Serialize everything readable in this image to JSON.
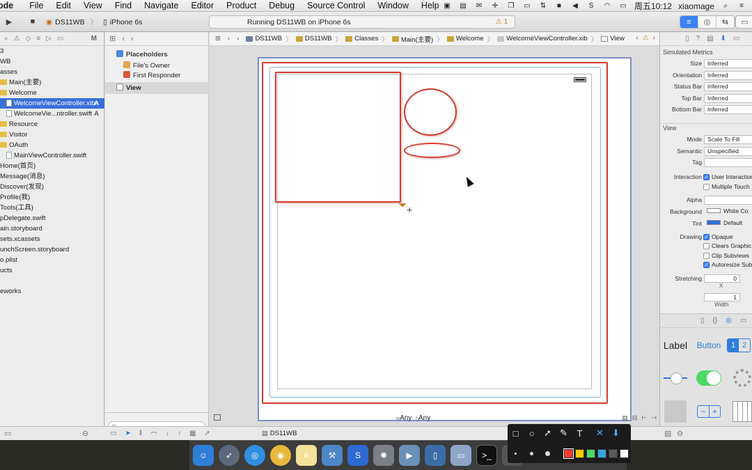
{
  "menubar": {
    "app_name": "ode",
    "items": [
      "File",
      "Edit",
      "View",
      "Find",
      "Navigate",
      "Editor",
      "Product",
      "Debug",
      "Source Control",
      "Window",
      "Help"
    ],
    "clock": "周五10:12",
    "user": "xiaomage"
  },
  "toolbar": {
    "scheme": "DS11WB",
    "device": "iPhone 6s",
    "activity_text": "Running DS11WB on iPhone 6s",
    "warning_count": "1"
  },
  "navigator": {
    "modified_header": "M",
    "items": [
      {
        "label": "3",
        "kind": "plain",
        "badge": ""
      },
      {
        "label": "WB",
        "kind": "plain",
        "badge": ""
      },
      {
        "label": "asses",
        "kind": "plain",
        "badge": ""
      },
      {
        "label": "Main(主要)",
        "kind": "folder",
        "badge": ""
      },
      {
        "label": "Welcome",
        "kind": "folder",
        "badge": ""
      },
      {
        "label": "WelcomeViewController.xib",
        "kind": "file",
        "badge": "A"
      },
      {
        "label": "WelcomeVie...ntroller.swift",
        "kind": "file",
        "badge": "A"
      },
      {
        "label": "Resource",
        "kind": "folder",
        "badge": ""
      },
      {
        "label": "Visitor",
        "kind": "folder",
        "badge": ""
      },
      {
        "label": "OAuth",
        "kind": "folder",
        "badge": ""
      },
      {
        "label": "MainViewController.swift",
        "kind": "file",
        "badge": ""
      },
      {
        "label": "Home(首页)",
        "kind": "plain",
        "badge": ""
      },
      {
        "label": "Message(消息)",
        "kind": "plain",
        "badge": ""
      },
      {
        "label": "Discover(发现)",
        "kind": "plain",
        "badge": ""
      },
      {
        "label": "Profile(我)",
        "kind": "plain",
        "badge": ""
      },
      {
        "label": "Tools(工具)",
        "kind": "plain",
        "badge": ""
      },
      {
        "label": "pDelegate.swift",
        "kind": "plain",
        "badge": ""
      },
      {
        "label": "ain.storyboard",
        "kind": "plain",
        "badge": ""
      },
      {
        "label": "sets.xcassets",
        "kind": "plain",
        "badge": ""
      },
      {
        "label": "unchScreen.storyboard",
        "kind": "plain",
        "badge": ""
      },
      {
        "label": "o.plist",
        "kind": "plain",
        "badge": ""
      },
      {
        "label": "ucts",
        "kind": "plain",
        "badge": ""
      },
      {
        "label": "",
        "kind": "plain",
        "badge": ""
      },
      {
        "label": "eworks",
        "kind": "plain",
        "badge": ""
      }
    ],
    "selected_index": 5
  },
  "outline": {
    "placeholders": "Placeholders",
    "files_owner": "File's Owner",
    "first_responder": "First Responder",
    "view": "View"
  },
  "jumpbar": {
    "crumbs": [
      "DS11WB",
      "DS11WB",
      "Classes",
      "Main(主要)",
      "Welcome",
      "WelcomeViewController.xib",
      "View"
    ]
  },
  "canvas": {
    "size_class_w": "w",
    "size_class_w_value": "Any",
    "size_class_h": "h",
    "size_class_h_value": "Any"
  },
  "inspector": {
    "simulated_metrics": "Simulated Metrics",
    "metrics": [
      {
        "label": "Size",
        "value": "Inferred"
      },
      {
        "label": "Orientation",
        "value": "Inferred"
      },
      {
        "label": "Status Bar",
        "value": "Inferred"
      },
      {
        "label": "Top Bar",
        "value": "Inferred"
      },
      {
        "label": "Bottom Bar",
        "value": "Inferred"
      }
    ],
    "view_section": "View",
    "view_props": [
      {
        "label": "Mode",
        "value": "Scale To Fill"
      },
      {
        "label": "Semantic",
        "value": "Unspecified"
      },
      {
        "label": "Tag",
        "value": ""
      }
    ],
    "interaction_label": "Interaction",
    "user_interaction": "User Interaction",
    "multiple_touch": "Multiple Touch",
    "alpha_label": "Alpha",
    "background_label": "Background",
    "background_value": "White Co",
    "background_color": "#ffffff",
    "tint_label": "Tint",
    "tint_value": "Default",
    "tint_color": "#2f6fdb",
    "drawing_label": "Drawing",
    "opaque": "Opaque",
    "clears_graphics": "Clears Graphic",
    "clip_subviews": "Clip Subviews",
    "autoresize": "Autoresize Sub",
    "stretching_label": "Stretching",
    "stretch_x": "0",
    "x_label": "X",
    "stretch_width": "1",
    "width_label": "Width"
  },
  "library": {
    "label_item": "Label",
    "button_item": "Button",
    "seg_items": [
      "1",
      "2"
    ]
  },
  "bottombar": {
    "target": "DS11WB"
  },
  "annotation_toolbar": {
    "colors": [
      "#ff3b30",
      "#ffcc00",
      "#4cd964",
      "#34aadc",
      "#5a5a5a",
      "#ffffff"
    ]
  },
  "colors": {
    "annotation_red": "#d53a2c",
    "selection_blue": "#3a6fd8"
  }
}
